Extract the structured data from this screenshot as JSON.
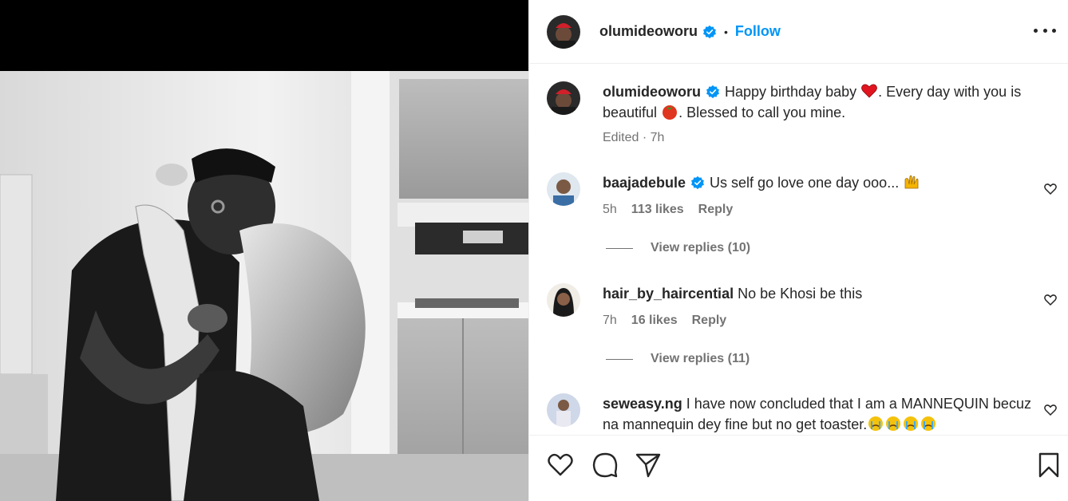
{
  "post": {
    "username": "olumideoworu",
    "follow_label": "Follow",
    "dot": "•",
    "caption_user": "olumideoworu",
    "caption_part1": "Happy birthday baby",
    "caption_part2": ". Every day with you is beautiful",
    "caption_part3": ". Blessed to call you mine.",
    "caption_meta": "Edited · 7h"
  },
  "comments": [
    {
      "username": "baajadebule",
      "text": "Us self go love one day ooo...",
      "time": "5h",
      "likes": "113 likes",
      "reply_label": "Reply",
      "view_replies": "View replies (10)"
    },
    {
      "username": "hair_by_haircential",
      "text": "No be Khosi be this",
      "time": "7h",
      "likes": "16 likes",
      "reply_label": "Reply",
      "view_replies": "View replies (11)"
    },
    {
      "username": "seweasy.ng",
      "text": "I have now concluded that I am a MANNEQUIN becuz na mannequin dey fine but no get toaster."
    }
  ],
  "icons": {
    "like": "heart-icon",
    "comment": "comment-icon",
    "share": "send-icon",
    "save": "bookmark-icon",
    "more": "more-options-icon"
  },
  "colors": {
    "accent": "#0095f6",
    "text": "#262626",
    "muted": "#737373",
    "border": "#efefef"
  }
}
